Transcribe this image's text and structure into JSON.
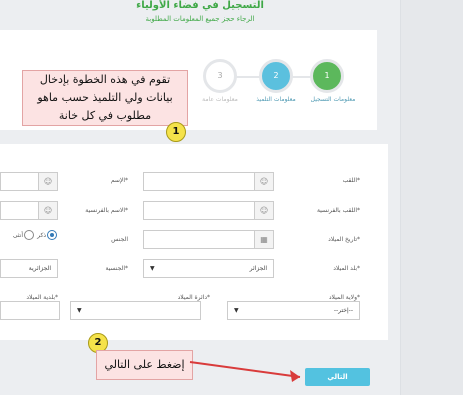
{
  "header": {
    "title": "التسجيل في فضاء الأولياء",
    "subtitle": "الرجاء حجز جميع المعلومات المطلوبة"
  },
  "steps": [
    {
      "number": "1",
      "label": "معلومات التسجيل",
      "color": "#5cb85c"
    },
    {
      "number": "2",
      "label": "معلومات التلميذ",
      "color": "#5bc0de"
    },
    {
      "number": "3",
      "label": "معلومات عامة",
      "color": "#ffffff"
    }
  ],
  "form": {
    "surname_label": "اللقب*",
    "surname_latin_label": "اللقب بالفرنسية*",
    "birthdate_label": "تاريخ الميلاد*",
    "birth_country_label": "بلد الميلاد*",
    "birth_country_value": "الجزائر",
    "birth_wilaya_label": "ولاية الميلاد*",
    "birth_wilaya_value": "--إختر--",
    "name_label": "الإسم*",
    "name_latin_label": "الاسم بالفرنسية*",
    "gender_label": "الجنس",
    "gender_male": "ذكر",
    "gender_female": "أنثى",
    "nationality_label": "الجنسية*",
    "nationality_value": "الجزائرية",
    "birth_daira_label": "دائرة الميلاد*",
    "birth_commune_label": "بلدية الميلاد*"
  },
  "callouts": {
    "step1_text": "تقوم في هذه الخطوة بإدخال بيانات ولي التلميذ حسب ماهو مطلوب في كل خانة",
    "step1_number": "1",
    "step2_text": "إضغط على التالي",
    "step2_number": "2"
  },
  "next_button": "التالي",
  "icons": {
    "user": "user-icon",
    "calendar": "calendar-icon",
    "caret": "caret-down-icon"
  }
}
